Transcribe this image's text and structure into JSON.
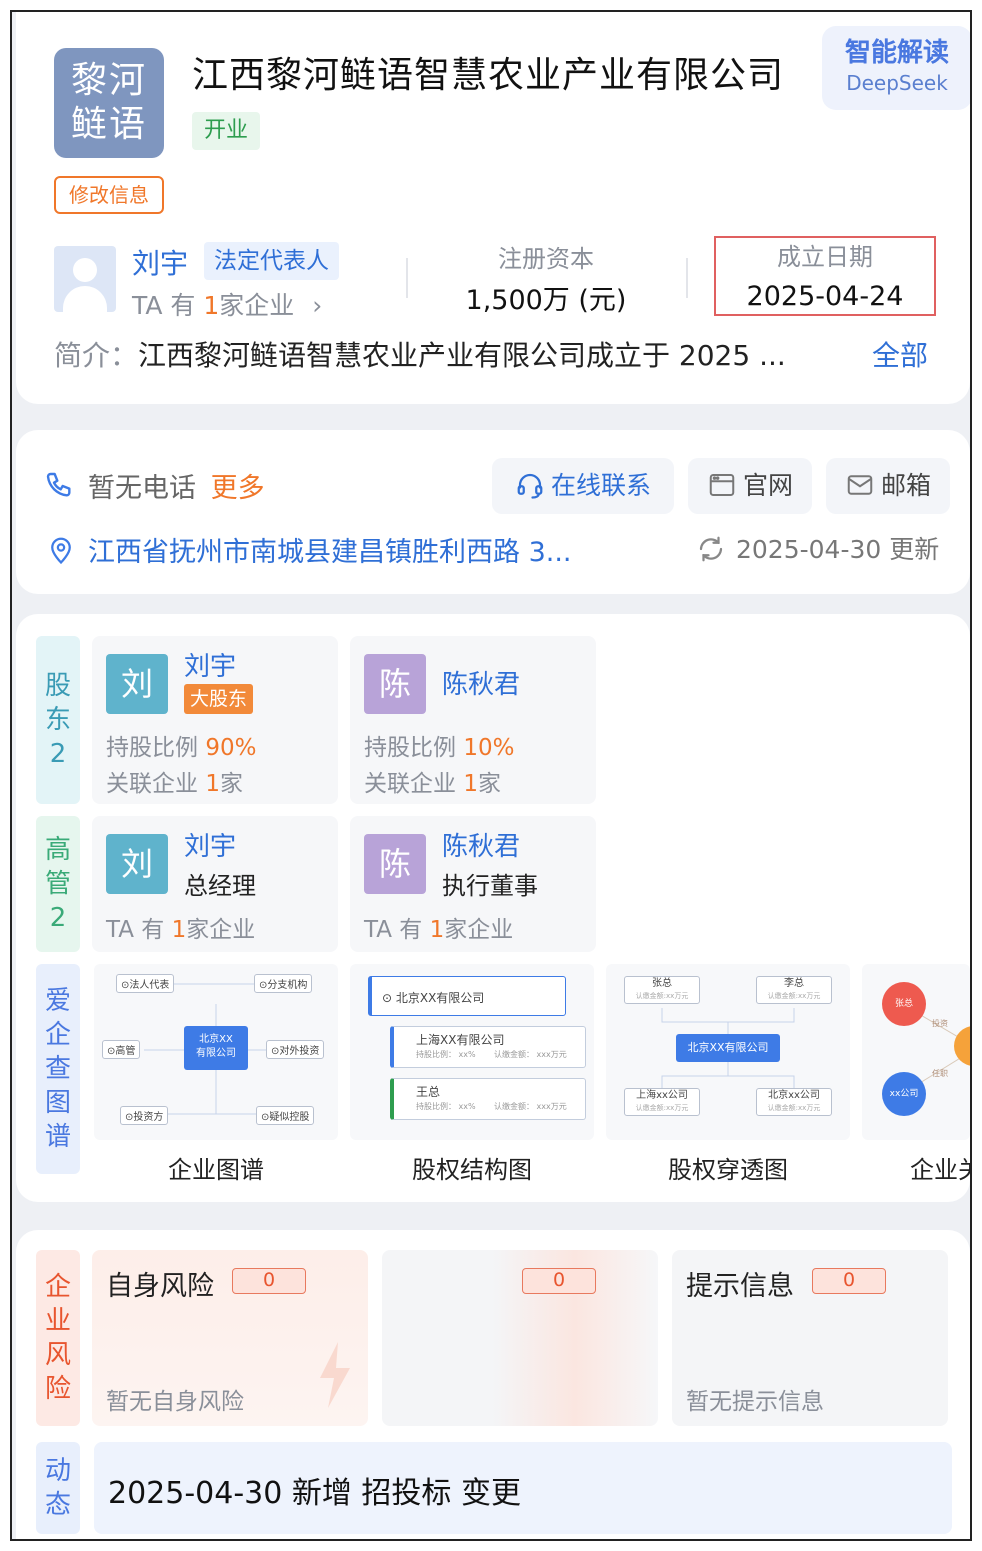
{
  "company": {
    "logo_line1": "黎河",
    "logo_line2": "鲢语",
    "name": "江西黎河鲢语智慧农业产业有限公司",
    "status": "开业",
    "edit_label": "修改信息"
  },
  "ai_badge": {
    "title": "智能解读",
    "subtitle": "DeepSeek"
  },
  "legal_rep": {
    "name": "刘宇",
    "tag": "法定代表人",
    "sub_prefix": "TA 有 ",
    "sub_count": "1",
    "sub_suffix": "家企业",
    "chevron": "›"
  },
  "stats": {
    "capital_label": "注册资本",
    "capital_value": "1,500万 (元)",
    "date_label": "成立日期",
    "date_value": "2025-04-24"
  },
  "intro": {
    "label": "简介：",
    "text": "江西黎河鲢语智慧农业产业有限公司成立于 2025 ...",
    "more": "全部"
  },
  "contact": {
    "phone": "暂无电话",
    "phone_more": "更多",
    "online": "在线联系",
    "website": "官网",
    "email": "邮箱",
    "address": "江西省抚州市南城县建昌镇胜利西路 3...",
    "updated": "2025-04-30 更新"
  },
  "shareholders": {
    "label_chars": [
      "股",
      "东",
      "2"
    ],
    "items": [
      {
        "avatar": "刘",
        "name": "刘宇",
        "tag": "大股东",
        "ratio_label": "持股比例 ",
        "ratio": "90%",
        "assoc_label": "关联企业 ",
        "assoc_count": "1",
        "assoc_unit": "家"
      },
      {
        "avatar": "陈",
        "name": "陈秋君",
        "tag": "",
        "ratio_label": "持股比例 ",
        "ratio": "10%",
        "assoc_label": "关联企业 ",
        "assoc_count": "1",
        "assoc_unit": "家"
      }
    ]
  },
  "executives": {
    "label_chars": [
      "高",
      "管",
      "2"
    ],
    "items": [
      {
        "avatar": "刘",
        "name": "刘宇",
        "role": "总经理",
        "line_prefix": "TA 有 ",
        "line_count": "1",
        "line_suffix": "家企业"
      },
      {
        "avatar": "陈",
        "name": "陈秋君",
        "role": "执行董事",
        "line_prefix": "TA 有 ",
        "line_count": "1",
        "line_suffix": "家企业"
      }
    ]
  },
  "graphs": {
    "label_chars": [
      "爱",
      "企",
      "查",
      "图",
      "谱"
    ],
    "items": [
      {
        "label": "企业图谱",
        "center": [
          "北京XX",
          "有限公司"
        ],
        "nodes": [
          "⊙法人代表",
          "⊙分支机构",
          "⊙高管",
          "⊙对外投资",
          "⊙投资方",
          "⊙疑似控股"
        ]
      },
      {
        "label": "股权结构图",
        "top": "⊙ 北京XX有限公司",
        "row1_title": "上海XX有限公司",
        "row2_title": "王总",
        "meta_a": "持股比例： xx%",
        "meta_b": "认缴金额： xxx万元"
      },
      {
        "label": "股权穿透图",
        "top_left": "张总",
        "top_right": "李总",
        "center": "北京XX有限公司",
        "bottom_left": "上海xx公司",
        "bottom_right": "北京xx公司",
        "meta": "认缴金额:xx万元"
      },
      {
        "label": "企业关",
        "nodes": [
          "张总",
          "xx公司",
          "投资",
          "任职"
        ]
      }
    ]
  },
  "risk": {
    "label_chars": [
      "企",
      "业",
      "风",
      "险"
    ],
    "self_title": "自身风险",
    "self_count": "0",
    "self_note": "暂无自身风险",
    "mid_count": "0",
    "hint_title": "提示信息",
    "hint_count": "0",
    "hint_note": "暂无提示信息"
  },
  "dynamics": {
    "label_chars": [
      "动",
      "态"
    ],
    "text": "2025-04-30 新增 招投标 变更"
  },
  "colors": {
    "accent_blue": "#2f6fd6",
    "accent_orange": "#f0772a",
    "status_green": "#2e9d4f",
    "logo_bg": "#7f96bf",
    "avatar_liu": "#5fb3cc",
    "avatar_chen": "#b8a3d8"
  },
  "icons": [
    "phone-icon",
    "headset-icon",
    "browser-icon",
    "mail-icon",
    "location-pin-icon",
    "refresh-icon",
    "chevron-right-icon",
    "user-avatar-icon"
  ]
}
